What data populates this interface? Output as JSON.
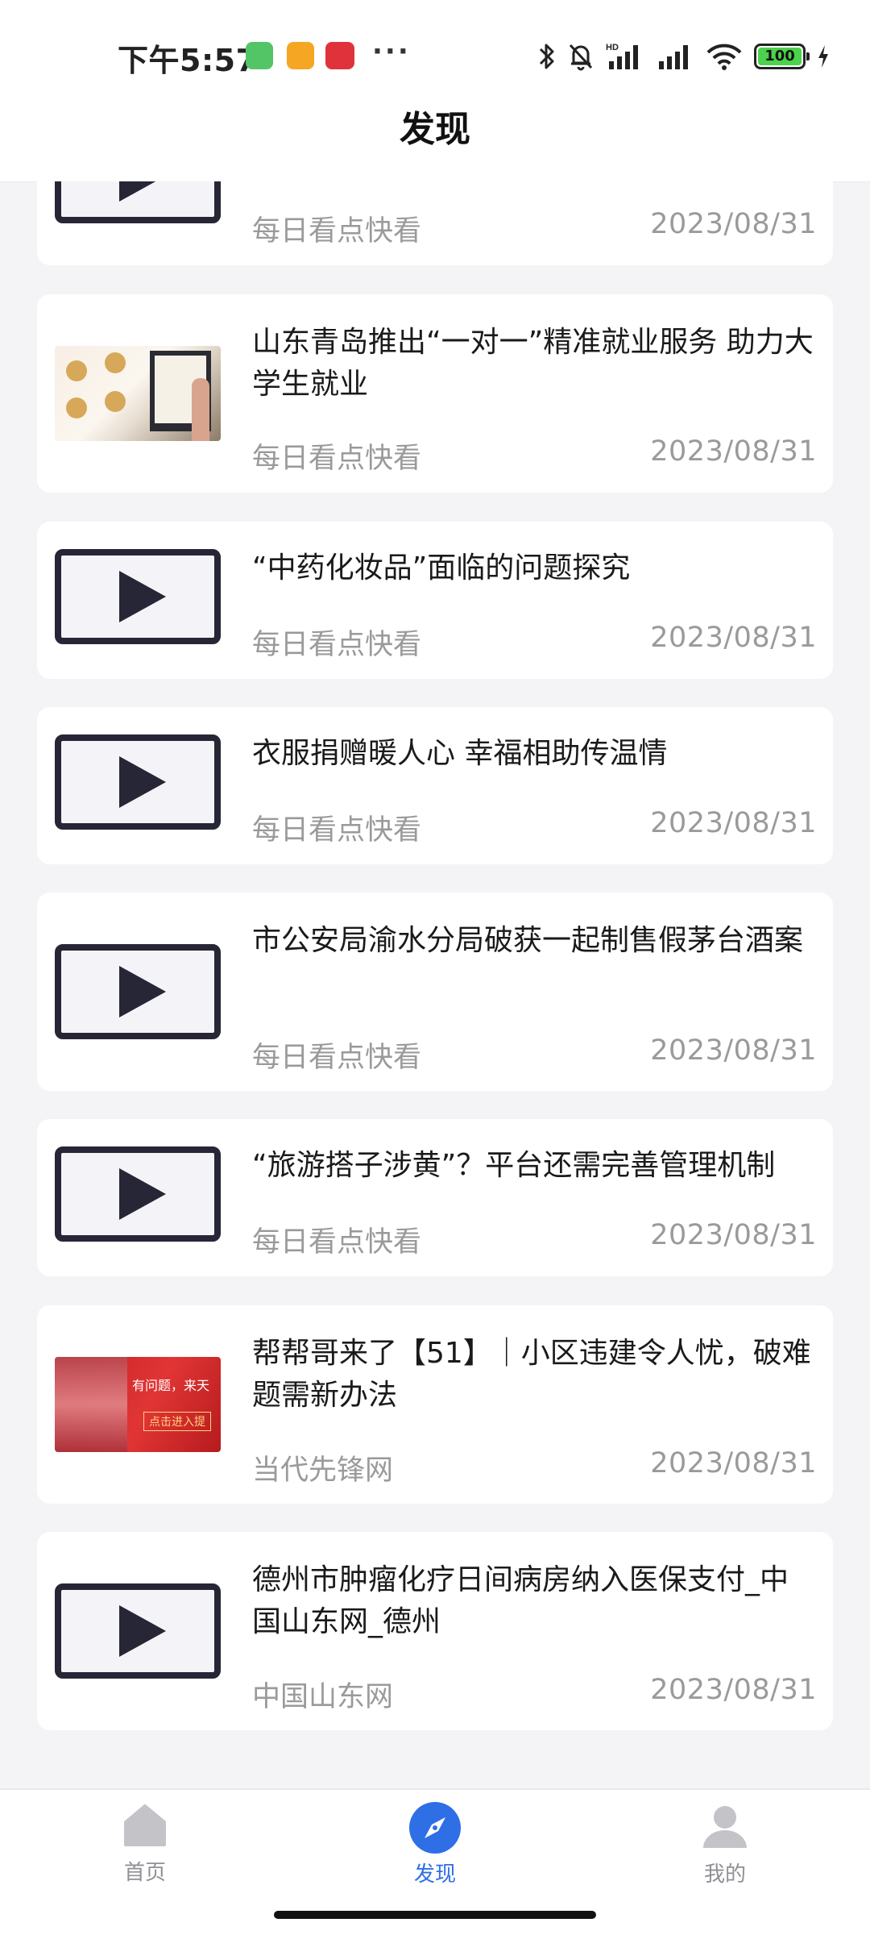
{
  "status_bar": {
    "time": "下午5:57",
    "more": "···",
    "battery": "100",
    "icons": [
      "bluetooth-icon",
      "bell-muted-icon",
      "hd-signal-icon",
      "signal-icon",
      "wifi-icon",
      "battery-icon",
      "charging-icon"
    ]
  },
  "header": {
    "title": "发现"
  },
  "feed": {
    "items": [
      {
        "title": "",
        "source": "每日看点快看",
        "date": "2023/08/31",
        "thumb": "video"
      },
      {
        "title": "山东青岛推出“一对一”精准就业服务 助力大学生就业",
        "source": "每日看点快看",
        "date": "2023/08/31",
        "thumb": "image"
      },
      {
        "title": "“中药化妆品”面临的问题探究",
        "source": "每日看点快看",
        "date": "2023/08/31",
        "thumb": "video"
      },
      {
        "title": "衣服捐赠暖人心 幸福相助传温情",
        "source": "每日看点快看",
        "date": "2023/08/31",
        "thumb": "video"
      },
      {
        "title": "市公安局渝水分局破获一起制售假茅台酒案",
        "source": "每日看点快看",
        "date": "2023/08/31",
        "thumb": "video"
      },
      {
        "title": "“旅游搭子涉黄”？平台还需完善管理机制",
        "source": "每日看点快看",
        "date": "2023/08/31",
        "thumb": "video"
      },
      {
        "title": "帮帮哥来了【51】｜小区违建令人忧，破难题需新办法",
        "source": "当代先锋网",
        "date": "2023/08/31",
        "thumb": "image",
        "thumb_text": [
          "有问题，来天",
          "点击进入提"
        ]
      },
      {
        "title": "德州市肿瘤化疗日间病房纳入医保支付_中国山东网_德州",
        "source": "中国山东网",
        "date": "2023/08/31",
        "thumb": "video"
      }
    ]
  },
  "bottom_nav": {
    "items": [
      {
        "label": "首页",
        "icon": "home-icon",
        "active": false
      },
      {
        "label": "发现",
        "icon": "compass-icon",
        "active": true
      },
      {
        "label": "我的",
        "icon": "person-icon",
        "active": false
      }
    ]
  },
  "colors": {
    "accent": "#2e6fe6",
    "inactive": "#8f8f95",
    "background": "#f4f4f6"
  }
}
